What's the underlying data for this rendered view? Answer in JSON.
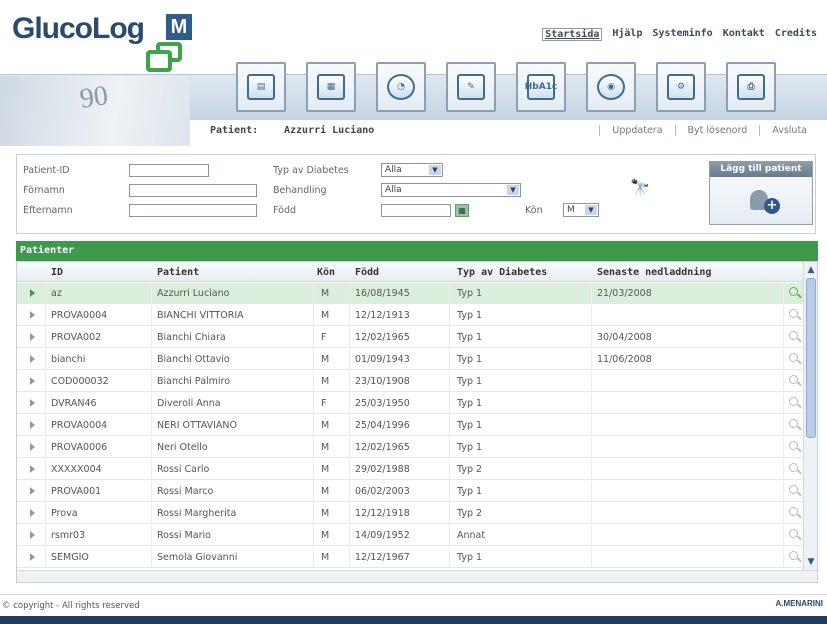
{
  "app": {
    "logo_text": "GlucoLog",
    "logo_mark": "M"
  },
  "topnav": [
    "Startsida",
    "Hjälp",
    "Systeminfo",
    "Kontakt",
    "Credits"
  ],
  "toolbar": {
    "ruler_number": "90",
    "icons": [
      "patient-card-icon",
      "calendar-icon",
      "chart-icon",
      "report-icon",
      "hba1c-icon",
      "device-icon",
      "settings-icon",
      "print-icon"
    ],
    "hba1c_label": "HbA1c"
  },
  "patient_bar": {
    "label": "Patient:",
    "name": "Azzurri Luciano",
    "links": [
      "Uppdatera",
      "Byt lösenord",
      "Avsluta"
    ]
  },
  "search": {
    "patient_id_label": "Patient-ID",
    "fornamn_label": "Förnamn",
    "efternamn_label": "Efternamn",
    "typ_label": "Typ av Diabetes",
    "typ_value": "Alla",
    "behandling_label": "Behandling",
    "behandling_value": "Alla",
    "fodd_label": "Född",
    "kon_label": "Kön",
    "kon_value": "M",
    "add_title": "Lägg till patient"
  },
  "table": {
    "section_title": "Patienter",
    "columns": [
      "ID",
      "Patient",
      "Kön",
      "Född",
      "Typ av Diabetes",
      "Senaste nedladdning"
    ],
    "rows": [
      {
        "id": "az",
        "patient": "Azzurri Luciano",
        "kon": "M",
        "fodd": "16/08/1945",
        "typ": "Typ 1",
        "senaste": "21/03/2008",
        "selected": true
      },
      {
        "id": "PROVA0004",
        "patient": "BIANCHI VITTORIA",
        "kon": "M",
        "fodd": "12/12/1913",
        "typ": "Typ 1",
        "senaste": ""
      },
      {
        "id": "PROVA002",
        "patient": "Bianchi Chiara",
        "kon": "F",
        "fodd": "12/02/1965",
        "typ": "Typ 1",
        "senaste": "30/04/2008"
      },
      {
        "id": "bianchi",
        "patient": "Bianchi Ottavio",
        "kon": "M",
        "fodd": "01/09/1943",
        "typ": "Typ 1",
        "senaste": "11/06/2008"
      },
      {
        "id": "COD000032",
        "patient": "Bianchi Palmiro",
        "kon": "M",
        "fodd": "23/10/1908",
        "typ": "Typ 1",
        "senaste": ""
      },
      {
        "id": "DVRAN46",
        "patient": "Diveroli Anna",
        "kon": "F",
        "fodd": "25/03/1950",
        "typ": "Typ 1",
        "senaste": ""
      },
      {
        "id": "PROVA0004",
        "patient": "NERI OTTAVIANO",
        "kon": "M",
        "fodd": "25/04/1996",
        "typ": "Typ 1",
        "senaste": ""
      },
      {
        "id": "PROVA0006",
        "patient": "Neri Otello",
        "kon": "M",
        "fodd": "12/02/1965",
        "typ": "Typ 1",
        "senaste": ""
      },
      {
        "id": "XXXXX004",
        "patient": "Rossi Carlo",
        "kon": "M",
        "fodd": "29/02/1988",
        "typ": "Typ 2",
        "senaste": ""
      },
      {
        "id": "PROVA001",
        "patient": "Rossi Marco",
        "kon": "M",
        "fodd": "06/02/2003",
        "typ": "Typ 1",
        "senaste": ""
      },
      {
        "id": "Prova",
        "patient": "Rossi Margherita",
        "kon": "M",
        "fodd": "12/12/1918",
        "typ": "Typ 2",
        "senaste": ""
      },
      {
        "id": "rsmr03",
        "patient": "Rossi Mario",
        "kon": "M",
        "fodd": "14/09/1952",
        "typ": "Annat",
        "senaste": ""
      },
      {
        "id": "SEMGIO",
        "patient": "Semola Giovanni",
        "kon": "M",
        "fodd": "12/12/1967",
        "typ": "Typ 1",
        "senaste": ""
      }
    ]
  },
  "footer": {
    "copyright": "© copyright - All rights reserved",
    "brand": "A.MENARINI"
  },
  "colors": {
    "green_header": "#3d9a4a",
    "selected_row": "#dcefdc",
    "logo_blue": "#2a4a6e"
  }
}
